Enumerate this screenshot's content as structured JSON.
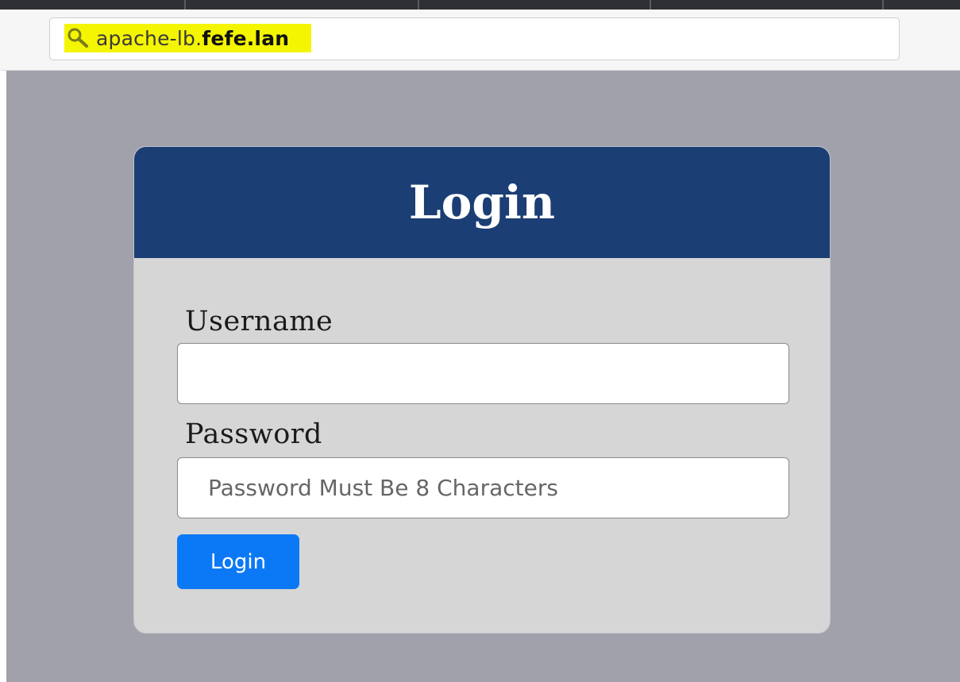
{
  "browser": {
    "url_prefix": "apache-lb.",
    "url_domain": "fefe.lan",
    "highlight_color": "#f4f500"
  },
  "login_card": {
    "title": "Login",
    "header_color": "#1b3e74",
    "username_label": "Username",
    "username_value": "",
    "password_label": "Password",
    "password_placeholder": "Password Must Be 8 Characters",
    "submit_label": "Login",
    "button_color": "#0b79f6"
  },
  "page": {
    "background_color": "#a1a1ab"
  }
}
